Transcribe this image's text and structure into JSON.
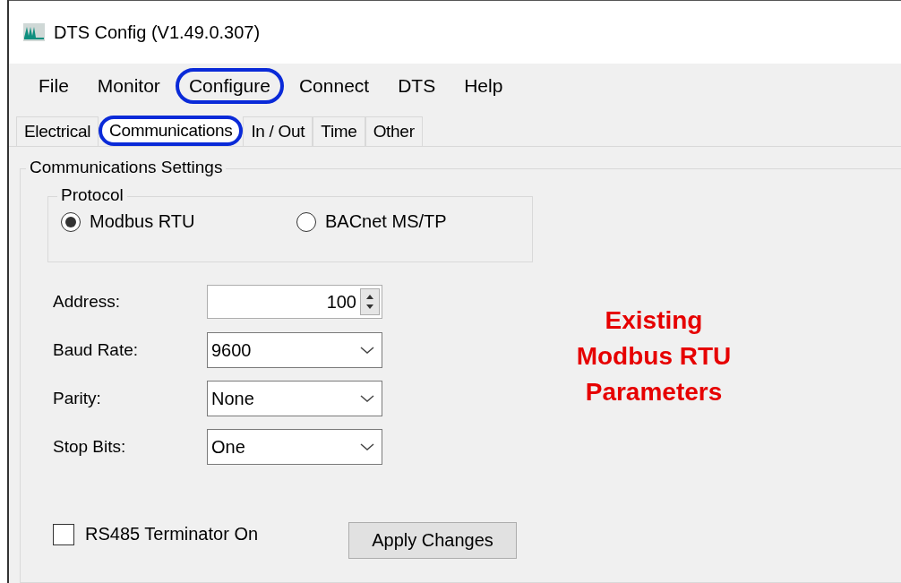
{
  "window": {
    "title": "DTS Config (V1.49.0.307)"
  },
  "menu": [
    {
      "label": "File",
      "highlighted": false
    },
    {
      "label": "Monitor",
      "highlighted": false
    },
    {
      "label": "Configure",
      "highlighted": true
    },
    {
      "label": "Connect",
      "highlighted": false
    },
    {
      "label": "DTS",
      "highlighted": false
    },
    {
      "label": "Help",
      "highlighted": false
    }
  ],
  "tabs": [
    {
      "label": "Electrical",
      "selected": false,
      "highlighted": false
    },
    {
      "label": "Communications",
      "selected": true,
      "highlighted": true
    },
    {
      "label": "In / Out",
      "selected": false,
      "highlighted": false
    },
    {
      "label": "Time",
      "selected": false,
      "highlighted": false
    },
    {
      "label": "Other",
      "selected": false,
      "highlighted": false
    }
  ],
  "settings": {
    "title": "Communications Settings",
    "protocol": {
      "title": "Protocol",
      "options": [
        {
          "label": "Modbus RTU",
          "selected": true
        },
        {
          "label": "BACnet MS/TP",
          "selected": false
        }
      ]
    },
    "fields": [
      {
        "kind": "spinner",
        "label": "Address:",
        "value": "100"
      },
      {
        "kind": "dropdown",
        "label": "Baud Rate:",
        "value": "9600"
      },
      {
        "kind": "dropdown",
        "label": "Parity:",
        "value": "None"
      },
      {
        "kind": "dropdown",
        "label": "Stop Bits:",
        "value": "One"
      }
    ],
    "terminator": {
      "label": "RS485 Terminator On",
      "checked": false
    },
    "apply_button": "Apply Changes"
  },
  "annotation": [
    "Existing",
    "Modbus RTU",
    "Parameters"
  ]
}
